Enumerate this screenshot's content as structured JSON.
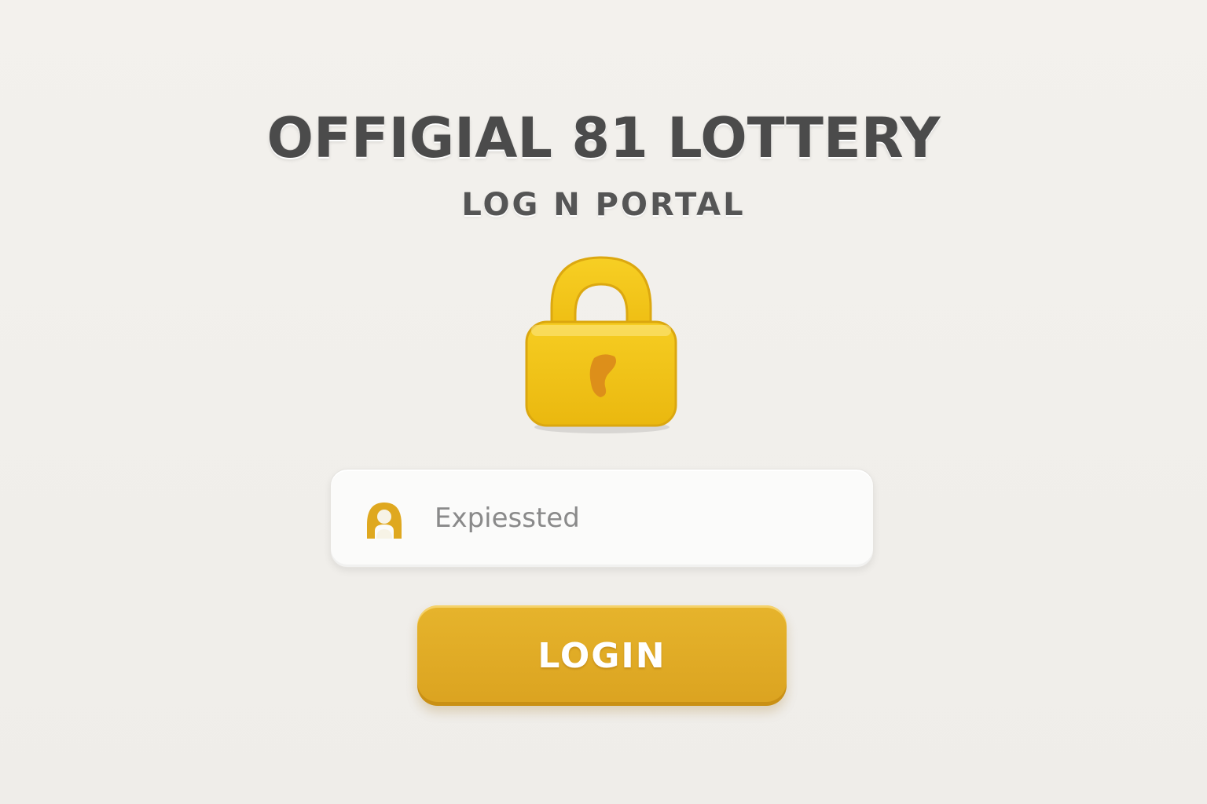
{
  "header": {
    "title": "OFFIGIAL 81 LOTTERY",
    "subtitle": "LOG N PORTAL"
  },
  "lock": {
    "icon": "padlock-icon",
    "color": "#f2c417",
    "keyhole_color": "#dd8f1a"
  },
  "username_field": {
    "icon": "user-avatar-icon",
    "value": "Expiessted"
  },
  "login_button": {
    "label": "LOGIN",
    "color": "#e0ab24"
  },
  "colors": {
    "background": "#f1efeb",
    "text": "#4b4b4b",
    "field_text": "#8a8a8a"
  }
}
